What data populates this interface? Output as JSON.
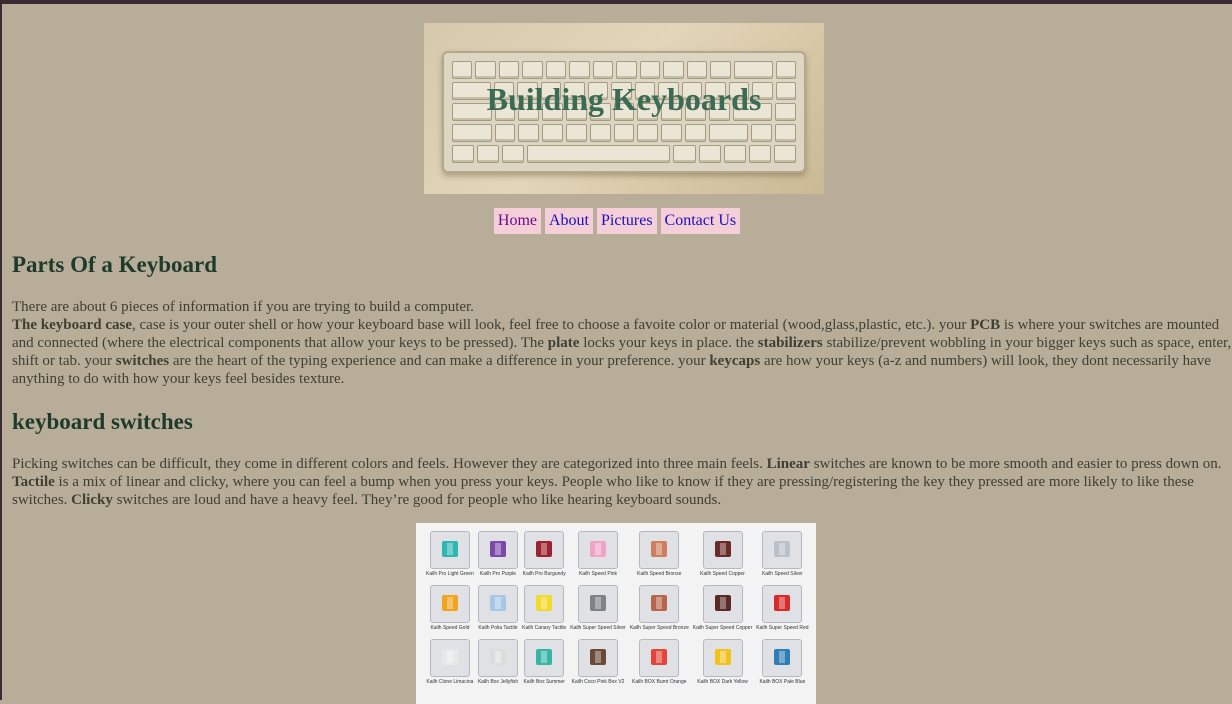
{
  "header": {
    "title": "Building Keyboards"
  },
  "nav": {
    "items": [
      "Home",
      "About",
      "Pictures",
      "Contact Us"
    ]
  },
  "section1": {
    "heading": "Parts Of a Keyboard",
    "intro": "There are about 6 pieces of information if you are trying to build a computer.",
    "case_label": "The keyboard case",
    "case_text": ", case is your outer shell or how your keyboard base will look, feel free to choose a favoite color or material (wood,glass,plastic, etc.). your ",
    "pcb_label": "PCB",
    "pcb_text": " is where your switches are mounted and connected (where the electrical components that allow your keys to be pressed). The ",
    "plate_label": "plate",
    "plate_text": " locks your keys in place. the ",
    "stab_label": "stabilizers",
    "stab_text": " stabilize/prevent wobbling in your bigger keys such as space, enter, shift or tab. your ",
    "switches_label": "switches",
    "switches_text": " are the heart of the typing experience and can make a difference in your preference. your ",
    "keycaps_label": "keycaps",
    "keycaps_text": " are how your keys (a-z and numbers) will look, they dont necessarily have anything to do with how your keys feel besides texture."
  },
  "section2": {
    "heading": "keyboard switches",
    "text1": "Picking switches can be difficult, they come in different colors and feels. However they are categorized into three main feels. ",
    "linear_label": "Linear",
    "text2": " switches are known to be more smooth and easier to press down on. ",
    "tactile_label": "Tactile",
    "text3": " is a mix of linear and clicky, where you can feel a bump when you press your keys. People who like to know if they are pressing/registering the key they pressed are more likely to like these switches. ",
    "clicky_label": "Clicky",
    "text4": " switches are loud and have a heavy feel. They’re good for people who like hearing keyboard sounds."
  },
  "switch_image": {
    "switches": [
      {
        "label": "Kailh Pro Light Green",
        "color": "#2fb7b3"
      },
      {
        "label": "Kailh Pro Purple",
        "color": "#7b4aa8"
      },
      {
        "label": "Kailh Pro Burgundy",
        "color": "#9b2231"
      },
      {
        "label": "Kailh Speed Pink",
        "color": "#f0a3c6"
      },
      {
        "label": "Kailh Speed Bronze",
        "color": "#cf7d5f"
      },
      {
        "label": "Kailh Speed Copper",
        "color": "#6a2c28"
      },
      {
        "label": "Kailh Speed Silver",
        "color": "#b9c1cb"
      },
      {
        "label": "Kailh Speed Gold",
        "color": "#f1a51f"
      },
      {
        "label": "Kailh Polia Tactile",
        "color": "#a8c6e6"
      },
      {
        "label": "Kailh Canary Tactile",
        "color": "#f4d92c"
      },
      {
        "label": "Kailh Super Speed Silver",
        "color": "#7d8288"
      },
      {
        "label": "Kailh Super Speed Bronze",
        "color": "#b7664c"
      },
      {
        "label": "Kailh Super Speed Copper",
        "color": "#5a2a26"
      },
      {
        "label": "Kailh Super Speed Red",
        "color": "#d52b2b"
      },
      {
        "label": "Kailh Clone Limacina",
        "color": "#e8e8ea"
      },
      {
        "label": "Kailh Box Jellyfish",
        "color": "#dcdcdc"
      },
      {
        "label": "Kailh Box Summer",
        "color": "#39b5a6"
      },
      {
        "label": "Kailh Coco Pink Box V2",
        "color": "#6b4a3a"
      },
      {
        "label": "Kailh BOX Burnt Orange",
        "color": "#e4453b"
      },
      {
        "label": "Kailh BOX Dark Yellow",
        "color": "#f1c21c"
      },
      {
        "label": "Kailh BOX Pale Blue",
        "color": "#2f7fb5"
      }
    ]
  }
}
